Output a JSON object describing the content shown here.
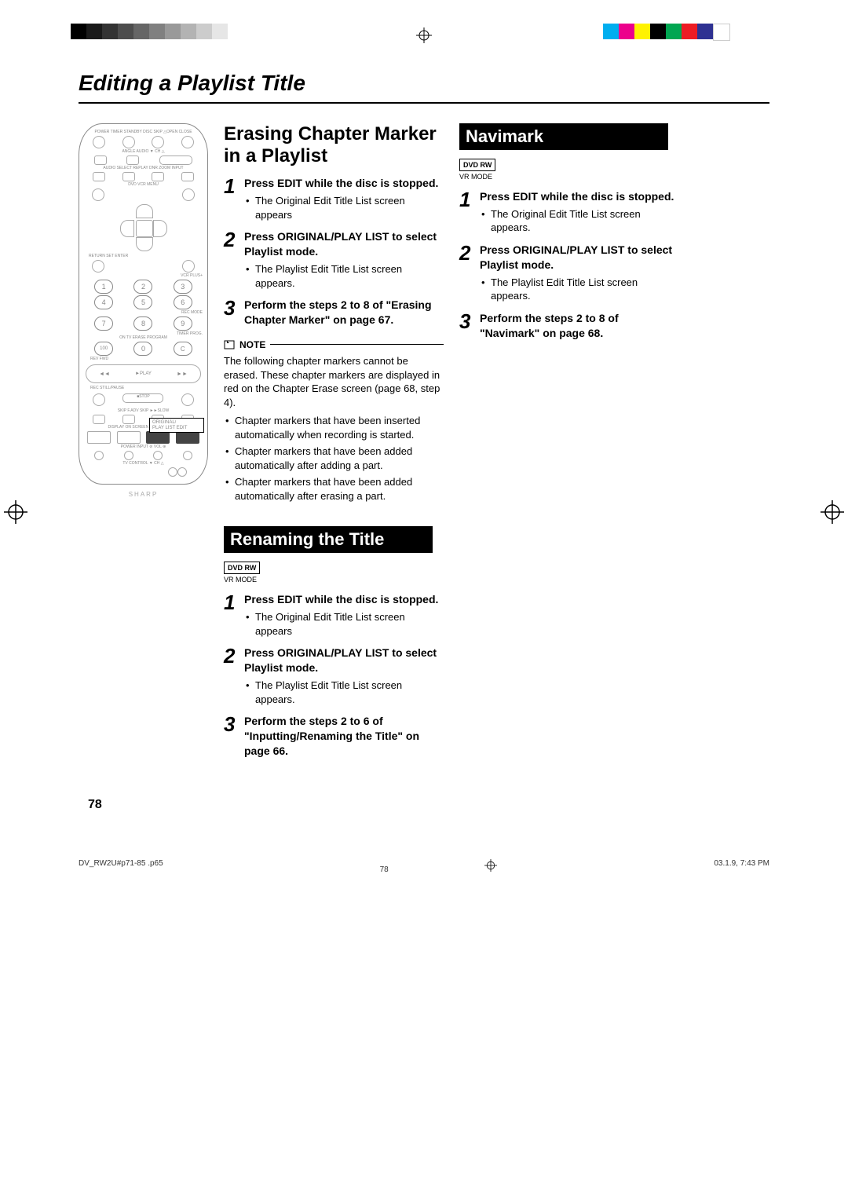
{
  "printerColors": {
    "left": [
      "#000",
      "#1a1a1a",
      "#333",
      "#4d4d4d",
      "#666",
      "#808080",
      "#999",
      "#b3b3b3",
      "#ccc",
      "#e6e6e6"
    ],
    "right": [
      "#00aeef",
      "#ec008c",
      "#fff200",
      "#000000",
      "#00a651",
      "#ed1c24",
      "#2e3192",
      "#ffffff"
    ]
  },
  "pageTitle": "Editing a Playlist Title",
  "remote": {
    "logo": "SHARP",
    "rowLabels": {
      "r1": "POWER   TIMER STANDBY   DISC SKIP   △OPEN CLOSE",
      "r2": "ANGLE   AUDIO   ▼  CH  △",
      "r3": "AUDIO SELECT REPLAY   DNR   ZOOM   INPUT",
      "r4": "DVD VCR                         MENU",
      "r5": "RETURN                   SET ENTER",
      "r6": "VCR PLUS+",
      "r7": "REC MODE",
      "r8": "TIMER PROG.",
      "r9": "ON TV   ERASE   PROGRAM",
      "r10": "REV                                 FWD",
      "r11": "REC                    STILL/PAUSE",
      "r12": "SKIP     F.ADV   SKIP    ►►SLOW",
      "r13": "DISPLAY ON SCREEN PLAY LIST EDIT",
      "r14": "POWER  INPUT   ⊘ VOL ⊕",
      "r15": "TV CONTROL   ▼  CH  △"
    },
    "highlighted": "ORIGINAL/\nPLAY LIST  EDIT",
    "play": "►PLAY",
    "stop": "■STOP"
  },
  "colLeft": {
    "heading": "Erasing Chapter Marker in a Playlist",
    "steps": [
      {
        "num": "1",
        "headParts": [
          "Press ",
          "EDIT",
          " while the disc is stopped."
        ],
        "bullet": "The Original Edit Title List screen appears"
      },
      {
        "num": "2",
        "headParts": [
          "Press ",
          "ORIGINAL/PLAY LIST",
          " to select Playlist mode."
        ],
        "bullet": "The Playlist Edit Title List screen appears."
      },
      {
        "num": "3",
        "headParts": [
          "Perform the steps ",
          "2",
          " to ",
          "8",
          " of \"Erasing Chapter Marker\" on page 67."
        ]
      }
    ],
    "note": {
      "label": "NOTE",
      "intro": "The following chapter markers cannot be erased. These chapter markers are displayed in red on the Chapter Erase screen (page 68, step 4).",
      "bullets": [
        "Chapter markers that have been inserted automatically when recording is started.",
        "Chapter markers that have been added automatically after adding a part.",
        "Chapter markers that have been added automatically after erasing a part."
      ]
    },
    "section2": {
      "heading": "Renaming the Title",
      "badge": "DVD RW",
      "mode": "VR MODE",
      "steps": [
        {
          "num": "1",
          "headParts": [
            "Press ",
            "EDIT",
            " while the disc is stopped."
          ],
          "bullet": "The Original Edit Title List screen appears"
        },
        {
          "num": "2",
          "headParts": [
            "Press ",
            "ORIGINAL/PLAY LIST",
            " to select Playlist mode."
          ],
          "bullet": "The Playlist Edit Title List screen appears."
        },
        {
          "num": "3",
          "headParts": [
            "Perform the steps ",
            "2",
            " to ",
            "6",
            " of \"Inputting/Renaming the Title\" on page 66."
          ]
        }
      ]
    }
  },
  "colRight": {
    "heading": "Navimark",
    "badge": "DVD RW",
    "mode": "VR MODE",
    "steps": [
      {
        "num": "1",
        "headParts": [
          "Press ",
          "EDIT",
          " while the disc is stopped."
        ],
        "bullet": "The Original Edit Title List screen appears."
      },
      {
        "num": "2",
        "headParts": [
          "Press ",
          "ORIGINAL/PLAY LIST",
          " to select Playlist mode."
        ],
        "bullet": "The Playlist Edit Title List screen appears."
      },
      {
        "num": "3",
        "headParts": [
          "Perform the steps ",
          "2",
          " to ",
          "8",
          " of \"Navimark\" on page 68."
        ]
      }
    ]
  },
  "pageNumber": "78",
  "footer": {
    "file": "DV_RW2U#p71-85 .p65",
    "page": "78",
    "timestamp": "03.1.9, 7:43 PM"
  }
}
